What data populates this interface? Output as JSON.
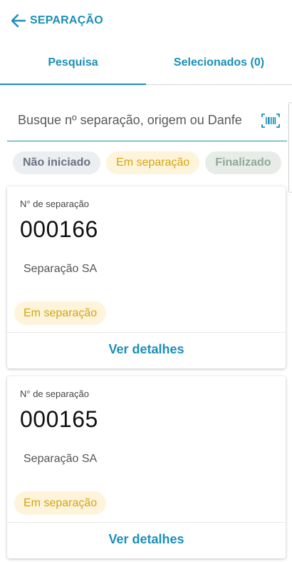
{
  "header": {
    "title": "SEPARAÇÃO",
    "back_icon": "arrow-left-icon"
  },
  "tabs": [
    {
      "label": "Pesquisa",
      "active": true
    },
    {
      "label": "Selecionados (0)",
      "active": false
    }
  ],
  "search": {
    "placeholder": "Busque nº separação, origem ou Danfe",
    "value": "",
    "scan_icon": "barcode-icon"
  },
  "filters": [
    {
      "label": "Não iniciado",
      "color": "#6b7280"
    },
    {
      "label": "Em separação",
      "color": "#d4a512"
    },
    {
      "label": "Finalizado",
      "color": "#8fa999"
    }
  ],
  "cards": [
    {
      "number_label": "N° de separação",
      "number": "000166",
      "origin": "Separação SA",
      "status": "Em separação",
      "action": "Ver detalhes"
    },
    {
      "number_label": "N° de separação",
      "number": "000165",
      "origin": "Separação SA",
      "status": "Em separação",
      "action": "Ver detalhes"
    }
  ],
  "colors": {
    "accent": "#1a8fb8",
    "status_yellow": "#d4a512",
    "status_yellow_bg": "#fdf4db"
  }
}
